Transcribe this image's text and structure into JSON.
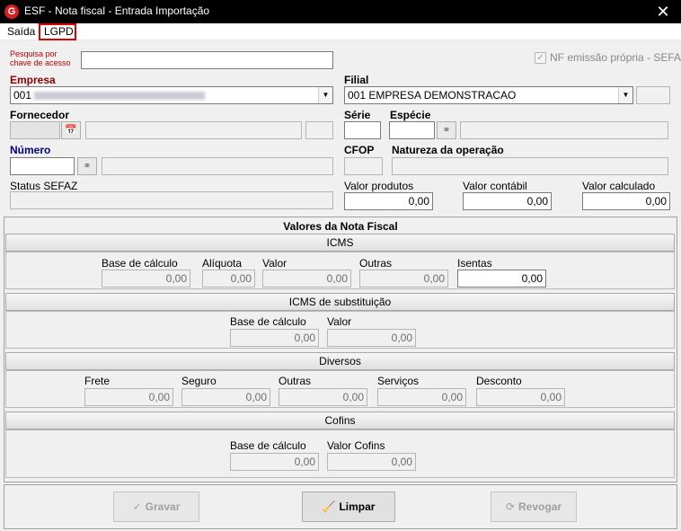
{
  "window": {
    "title": "ESF - Nota fiscal - Entrada Importação"
  },
  "menu": {
    "items": [
      {
        "label": "Saída"
      },
      {
        "label": "LGPD"
      }
    ]
  },
  "header": {
    "search_label": "Pesquisa por chave de acesso",
    "search_value": "",
    "nf_propria_label": "NF emissão própria - SEFAZ",
    "empresa_label": "Empresa",
    "empresa_value": "001",
    "filial_label": "Filial",
    "filial_value": "001 EMPRESA DEMONSTRACAO",
    "fornecedor_label": "Fornecedor",
    "serie_label": "Série",
    "especie_label": "Espécie",
    "numero_label": "Número",
    "cfop_label": "CFOP",
    "natureza_label": "Natureza da operação",
    "status_label": "Status SEFAZ",
    "valor_produtos_label": "Valor produtos",
    "valor_produtos_value": "0,00",
    "valor_contabil_label": "Valor contábil",
    "valor_contabil_value": "0,00",
    "valor_calculado_label": "Valor calculado",
    "valor_calculado_value": "0,00"
  },
  "valores": {
    "title": "Valores da Nota Fiscal",
    "icms": {
      "title": "ICMS",
      "base_label": "Base de cálculo",
      "base_value": "0,00",
      "aliquota_label": "Alíquota",
      "aliquota_value": "0,00",
      "valor_label": "Valor",
      "valor_value": "0,00",
      "outras_label": "Outras",
      "outras_value": "0,00",
      "isentas_label": "Isentas",
      "isentas_value": "0,00"
    },
    "icms_st": {
      "title": "ICMS de substituição",
      "base_label": "Base de cálculo",
      "base_value": "0,00",
      "valor_label": "Valor",
      "valor_value": "0,00"
    },
    "diversos": {
      "title": "Diversos",
      "frete_label": "Frete",
      "frete_value": "0,00",
      "seguro_label": "Seguro",
      "seguro_value": "0,00",
      "outras_label": "Outras",
      "outras_value": "0,00",
      "servicos_label": "Serviços",
      "servicos_value": "0,00",
      "desconto_label": "Desconto",
      "desconto_value": "0,00"
    },
    "cofins": {
      "title": "Cofins",
      "base_label": "Base de cálculo",
      "base_value": "0,00",
      "valor_label": "Valor Cofins",
      "valor_value": "0,00"
    }
  },
  "footer": {
    "gravar_label": "Gravar",
    "limpar_label": "Limpar",
    "revogar_label": "Revogar"
  },
  "colors": {
    "title_bar": "#000000",
    "highlight_red": "#e00000",
    "empresa_label": "#8b0000",
    "numero_label": "#000080"
  },
  "icons": {
    "app": "esf-logo-icon",
    "close": "close-icon",
    "search_fornecedor": "calendar-search-icon",
    "binoculars": "binoculars-icon",
    "gravar": "checkmark-icon",
    "limpar": "broom-icon",
    "revogar": "refresh-icon"
  }
}
